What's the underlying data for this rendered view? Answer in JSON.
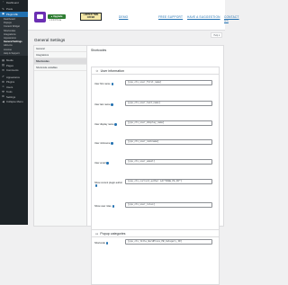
{
  "sidebar": {
    "items": [
      {
        "label": "Dashboard",
        "icon": "dashboard-icon",
        "glyph": "◔"
      },
      {
        "label": "Posts",
        "icon": "pin-icon",
        "glyph": "✎"
      },
      {
        "label": "Plugin ME",
        "icon": "plugin-icon",
        "glyph": "▣",
        "active": true
      }
    ],
    "subitems": [
      {
        "label": "Dashboard"
      },
      {
        "label": "Popups"
      },
      {
        "label": "Content Widget"
      },
      {
        "label": "Shortcodes"
      },
      {
        "label": "Integrations"
      },
      {
        "label": "Appearance"
      },
      {
        "label": "General Settings",
        "current": true
      },
      {
        "label": "Add-ons"
      },
      {
        "label": "License"
      },
      {
        "label": "Help & Support"
      }
    ],
    "items_after": [
      {
        "label": "Media",
        "icon": "media-icon",
        "glyph": "▤"
      },
      {
        "label": "Pages",
        "icon": "pages-icon",
        "glyph": "▥"
      },
      {
        "label": "Comments",
        "icon": "comments-icon",
        "glyph": "✉"
      },
      {
        "label": "Appearance",
        "icon": "brush-icon",
        "glyph": "✐"
      },
      {
        "label": "Plugins",
        "icon": "plugins-icon",
        "glyph": "⚙"
      },
      {
        "label": "Users",
        "icon": "users-icon",
        "glyph": "☺"
      },
      {
        "label": "Tools",
        "icon": "tools-icon",
        "glyph": "⚒"
      },
      {
        "label": "Settings",
        "icon": "settings-icon",
        "glyph": "⚙"
      },
      {
        "label": "Collapse Menu",
        "icon": "collapse-icon",
        "glyph": "◀"
      }
    ]
  },
  "header": {
    "upgrade_label": "● Upgrade",
    "version": "v 2.0.0.5 Lite",
    "offer_label": "LIMITED TIME OFFER",
    "links": {
      "demo": "DEMO",
      "free_support": "FREE SUPPORT",
      "have_suggestion": "HAVE A SUGGESTION",
      "contact_us": "CONTACT US"
    },
    "screen_options": "Help ▾"
  },
  "page": {
    "title": "General Settings",
    "tabs": [
      {
        "label": "General"
      },
      {
        "label": "Integrations"
      },
      {
        "label": "Shortcodes",
        "active": true
      },
      {
        "label": "Shortcode variables"
      }
    ],
    "content_title": "Shortcodes",
    "user_info": {
      "title": "User information",
      "fields": [
        {
          "label": "User first name",
          "value": "[ppu_ctx_user_first_name]"
        },
        {
          "label": "User last name",
          "value": "[ppu_ctx_user_last_name]"
        },
        {
          "label": "User display name",
          "value": "[ppu_ctx_user_display_name]"
        },
        {
          "label": "User nickname",
          "value": "[ppu_ctx_user_nickname]"
        },
        {
          "label": "User email",
          "value": "[ppu_ctx_user_email]"
        },
        {
          "label": "Show current plugin author",
          "value": "[ppu_ctx_current_author id=\"PAGE_PG_ID\"]"
        },
        {
          "label": "Show user roles",
          "value": "[ppu_ctx_user_roles]"
        }
      ]
    },
    "popup_categories": {
      "title": "Popup categories",
      "fields": [
        {
          "label": "Shortcode",
          "value": "[ppu_ctx_title_WordPress_PB_Category_ID]"
        }
      ]
    }
  }
}
